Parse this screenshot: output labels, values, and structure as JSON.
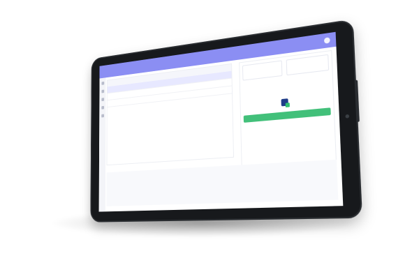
{
  "device": {
    "type": "tablet",
    "orientation": "landscape"
  },
  "app": {
    "topbar_user": "",
    "colors": {
      "accent": "#8b8ef3",
      "success": "#42c07a",
      "brand_dark": "#1f3c88"
    }
  },
  "left_table": {
    "headers": [
      "",
      "",
      "",
      "",
      ""
    ],
    "rows": [
      [
        "",
        "",
        "",
        "",
        ""
      ],
      [
        "",
        "",
        "",
        "",
        ""
      ],
      [
        "",
        "",
        "",
        "",
        ""
      ]
    ]
  },
  "right_panel": {
    "stats": [
      {
        "label": "",
        "value": ""
      },
      {
        "label": "",
        "value": ""
      }
    ],
    "summary": [
      {
        "label": "",
        "value": ""
      },
      {
        "label": "",
        "value": ""
      },
      {
        "label": "",
        "value": ""
      }
    ],
    "info": [
      {
        "label": "",
        "value": ""
      },
      {
        "label": "",
        "value": ""
      },
      {
        "label": "",
        "value": ""
      }
    ],
    "logo_text": "",
    "primary_action_label": ""
  }
}
